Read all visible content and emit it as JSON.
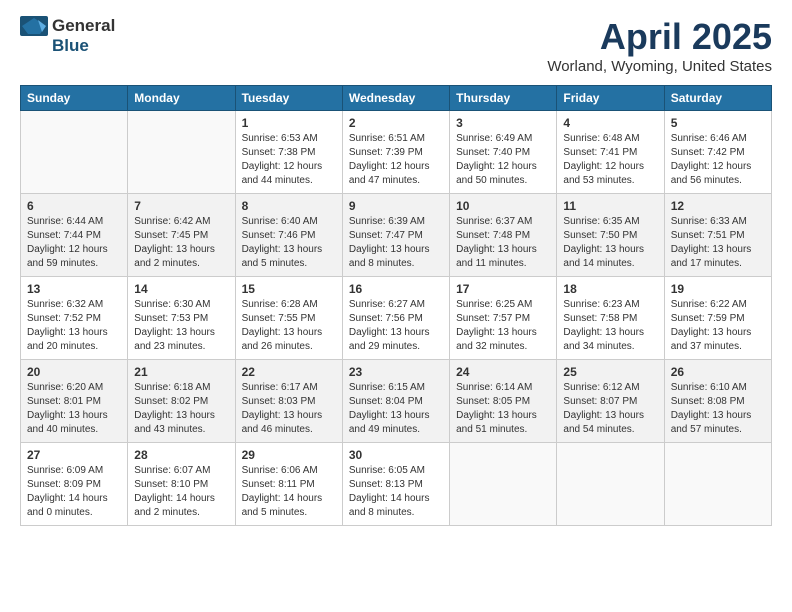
{
  "logo": {
    "general": "General",
    "blue": "Blue"
  },
  "title": "April 2025",
  "location": "Worland, Wyoming, United States",
  "headers": [
    "Sunday",
    "Monday",
    "Tuesday",
    "Wednesday",
    "Thursday",
    "Friday",
    "Saturday"
  ],
  "weeks": [
    {
      "shaded": false,
      "days": [
        {
          "num": "",
          "detail": ""
        },
        {
          "num": "",
          "detail": ""
        },
        {
          "num": "1",
          "detail": "Sunrise: 6:53 AM\nSunset: 7:38 PM\nDaylight: 12 hours and 44 minutes."
        },
        {
          "num": "2",
          "detail": "Sunrise: 6:51 AM\nSunset: 7:39 PM\nDaylight: 12 hours and 47 minutes."
        },
        {
          "num": "3",
          "detail": "Sunrise: 6:49 AM\nSunset: 7:40 PM\nDaylight: 12 hours and 50 minutes."
        },
        {
          "num": "4",
          "detail": "Sunrise: 6:48 AM\nSunset: 7:41 PM\nDaylight: 12 hours and 53 minutes."
        },
        {
          "num": "5",
          "detail": "Sunrise: 6:46 AM\nSunset: 7:42 PM\nDaylight: 12 hours and 56 minutes."
        }
      ]
    },
    {
      "shaded": true,
      "days": [
        {
          "num": "6",
          "detail": "Sunrise: 6:44 AM\nSunset: 7:44 PM\nDaylight: 12 hours and 59 minutes."
        },
        {
          "num": "7",
          "detail": "Sunrise: 6:42 AM\nSunset: 7:45 PM\nDaylight: 13 hours and 2 minutes."
        },
        {
          "num": "8",
          "detail": "Sunrise: 6:40 AM\nSunset: 7:46 PM\nDaylight: 13 hours and 5 minutes."
        },
        {
          "num": "9",
          "detail": "Sunrise: 6:39 AM\nSunset: 7:47 PM\nDaylight: 13 hours and 8 minutes."
        },
        {
          "num": "10",
          "detail": "Sunrise: 6:37 AM\nSunset: 7:48 PM\nDaylight: 13 hours and 11 minutes."
        },
        {
          "num": "11",
          "detail": "Sunrise: 6:35 AM\nSunset: 7:50 PM\nDaylight: 13 hours and 14 minutes."
        },
        {
          "num": "12",
          "detail": "Sunrise: 6:33 AM\nSunset: 7:51 PM\nDaylight: 13 hours and 17 minutes."
        }
      ]
    },
    {
      "shaded": false,
      "days": [
        {
          "num": "13",
          "detail": "Sunrise: 6:32 AM\nSunset: 7:52 PM\nDaylight: 13 hours and 20 minutes."
        },
        {
          "num": "14",
          "detail": "Sunrise: 6:30 AM\nSunset: 7:53 PM\nDaylight: 13 hours and 23 minutes."
        },
        {
          "num": "15",
          "detail": "Sunrise: 6:28 AM\nSunset: 7:55 PM\nDaylight: 13 hours and 26 minutes."
        },
        {
          "num": "16",
          "detail": "Sunrise: 6:27 AM\nSunset: 7:56 PM\nDaylight: 13 hours and 29 minutes."
        },
        {
          "num": "17",
          "detail": "Sunrise: 6:25 AM\nSunset: 7:57 PM\nDaylight: 13 hours and 32 minutes."
        },
        {
          "num": "18",
          "detail": "Sunrise: 6:23 AM\nSunset: 7:58 PM\nDaylight: 13 hours and 34 minutes."
        },
        {
          "num": "19",
          "detail": "Sunrise: 6:22 AM\nSunset: 7:59 PM\nDaylight: 13 hours and 37 minutes."
        }
      ]
    },
    {
      "shaded": true,
      "days": [
        {
          "num": "20",
          "detail": "Sunrise: 6:20 AM\nSunset: 8:01 PM\nDaylight: 13 hours and 40 minutes."
        },
        {
          "num": "21",
          "detail": "Sunrise: 6:18 AM\nSunset: 8:02 PM\nDaylight: 13 hours and 43 minutes."
        },
        {
          "num": "22",
          "detail": "Sunrise: 6:17 AM\nSunset: 8:03 PM\nDaylight: 13 hours and 46 minutes."
        },
        {
          "num": "23",
          "detail": "Sunrise: 6:15 AM\nSunset: 8:04 PM\nDaylight: 13 hours and 49 minutes."
        },
        {
          "num": "24",
          "detail": "Sunrise: 6:14 AM\nSunset: 8:05 PM\nDaylight: 13 hours and 51 minutes."
        },
        {
          "num": "25",
          "detail": "Sunrise: 6:12 AM\nSunset: 8:07 PM\nDaylight: 13 hours and 54 minutes."
        },
        {
          "num": "26",
          "detail": "Sunrise: 6:10 AM\nSunset: 8:08 PM\nDaylight: 13 hours and 57 minutes."
        }
      ]
    },
    {
      "shaded": false,
      "days": [
        {
          "num": "27",
          "detail": "Sunrise: 6:09 AM\nSunset: 8:09 PM\nDaylight: 14 hours and 0 minutes."
        },
        {
          "num": "28",
          "detail": "Sunrise: 6:07 AM\nSunset: 8:10 PM\nDaylight: 14 hours and 2 minutes."
        },
        {
          "num": "29",
          "detail": "Sunrise: 6:06 AM\nSunset: 8:11 PM\nDaylight: 14 hours and 5 minutes."
        },
        {
          "num": "30",
          "detail": "Sunrise: 6:05 AM\nSunset: 8:13 PM\nDaylight: 14 hours and 8 minutes."
        },
        {
          "num": "",
          "detail": ""
        },
        {
          "num": "",
          "detail": ""
        },
        {
          "num": "",
          "detail": ""
        }
      ]
    }
  ]
}
